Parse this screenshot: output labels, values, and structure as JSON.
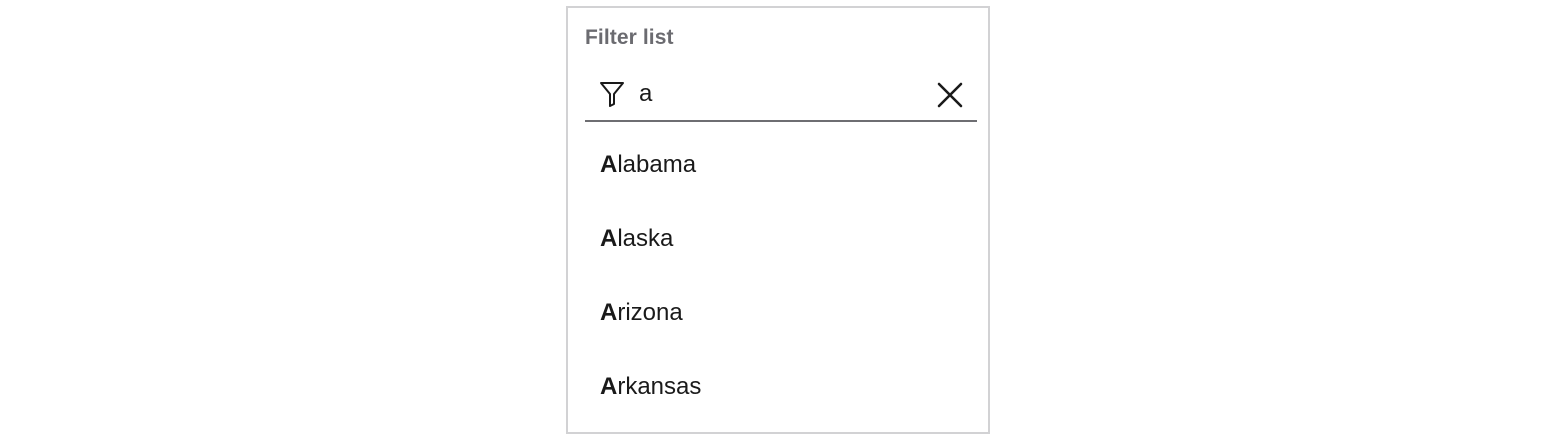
{
  "filter": {
    "label": "Filter list",
    "value": "a",
    "filter_icon": "filter-funnel-icon",
    "clear_icon": "close-x-icon"
  },
  "options": [
    {
      "match": "A",
      "rest": "labama"
    },
    {
      "match": "A",
      "rest": "laska"
    },
    {
      "match": "A",
      "rest": "rizona"
    },
    {
      "match": "A",
      "rest": "rkansas"
    }
  ],
  "colors": {
    "border": "#d2d2d4",
    "underline": "#6e6e72",
    "label": "#6b6b70",
    "text": "#1a1a1a"
  }
}
